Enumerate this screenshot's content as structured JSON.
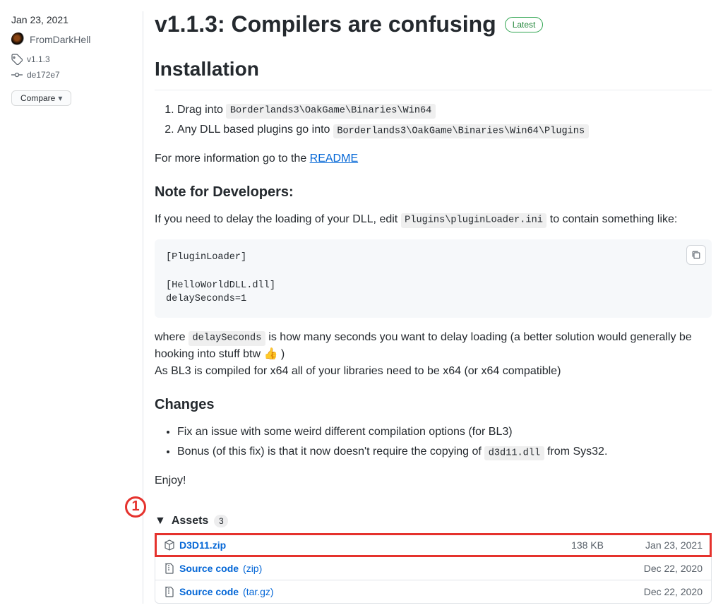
{
  "sidebar": {
    "date": "Jan 23, 2021",
    "author": "FromDarkHell",
    "tag": "v1.1.3",
    "commit": "de172e7",
    "compare_label": "Compare"
  },
  "release": {
    "title": "v1.1.3: Compilers are confusing",
    "latest_badge": "Latest"
  },
  "content": {
    "installation_heading": "Installation",
    "step1_prefix": "Drag into ",
    "step1_code": "Borderlands3\\OakGame\\Binaries\\Win64",
    "step2_prefix": "Any DLL based plugins go into ",
    "step2_code": "Borderlands3\\OakGame\\Binaries\\Win64\\Plugins",
    "more_info_prefix": "For more information go to the ",
    "readme_link": "README",
    "dev_note_heading": "Note for Developers:",
    "dev_note_text_pre": "If you need to delay the loading of your DLL, edit ",
    "dev_note_code": "Plugins\\pluginLoader.ini",
    "dev_note_text_post": " to contain something like:",
    "codeblock": "[PluginLoader]\n\n[HelloWorldDLL.dll]\ndelaySeconds=1",
    "where_pre": "where ",
    "where_code": "delaySeconds",
    "where_post": " is how many seconds you want to delay loading (a better solution would generally be hooking into stuff btw ",
    "where_emoji": "👍",
    "where_close": " )",
    "x64_note": "As BL3 is compiled for x64 all of your libraries need to be x64 (or x64 compatible)",
    "changes_heading": "Changes",
    "change1": "Fix an issue with some weird different compilation options (for BL3)",
    "change2_pre": "Bonus (of this fix) is that it now doesn't require the copying of ",
    "change2_code": "d3d11.dll",
    "change2_post": " from Sys32.",
    "enjoy": "Enjoy!"
  },
  "assets": {
    "heading": "Assets",
    "count": "3",
    "annotation": "1",
    "items": [
      {
        "name": "D3D11.zip",
        "suffix": "",
        "size": "138 KB",
        "date": "Jan 23, 2021",
        "icon": "package",
        "hl": true
      },
      {
        "name": "Source code",
        "suffix": " (zip)",
        "size": "",
        "date": "Dec 22, 2020",
        "icon": "zip",
        "hl": false
      },
      {
        "name": "Source code",
        "suffix": " (tar.gz)",
        "size": "",
        "date": "Dec 22, 2020",
        "icon": "zip",
        "hl": false
      }
    ]
  }
}
